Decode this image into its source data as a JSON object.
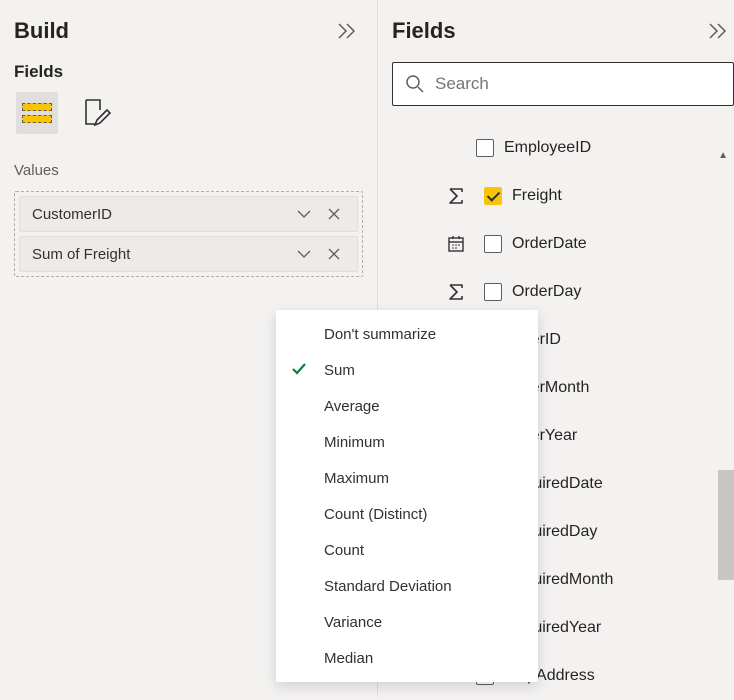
{
  "build": {
    "title": "Build",
    "fields_label": "Fields",
    "values_label": "Values",
    "values": [
      {
        "label": "CustomerID"
      },
      {
        "label": "Sum of Freight"
      }
    ]
  },
  "fields_panel": {
    "title": "Fields",
    "search_placeholder": "Search",
    "fields": [
      {
        "label": "EmployeeID",
        "checked": false,
        "type": "none"
      },
      {
        "label": "Freight",
        "checked": true,
        "type": "sigma"
      },
      {
        "label": "OrderDate",
        "checked": false,
        "type": "calendar"
      },
      {
        "label": "OrderDay",
        "checked": false,
        "type": "sigma"
      },
      {
        "label": "OrderID",
        "checked": false,
        "type": "none"
      },
      {
        "label": "OrderMonth",
        "checked": false,
        "type": "none"
      },
      {
        "label": "OrderYear",
        "checked": false,
        "type": "none"
      },
      {
        "label": "RequiredDate",
        "checked": false,
        "type": "none"
      },
      {
        "label": "RequiredDay",
        "checked": false,
        "type": "none"
      },
      {
        "label": "RequiredMonth",
        "checked": false,
        "type": "none"
      },
      {
        "label": "RequiredYear",
        "checked": false,
        "type": "none"
      },
      {
        "label": "ShipAddress",
        "checked": false,
        "type": "none"
      }
    ]
  },
  "context_menu": {
    "items": [
      {
        "label": "Don't summarize",
        "checked": false
      },
      {
        "label": "Sum",
        "checked": true
      },
      {
        "label": "Average",
        "checked": false
      },
      {
        "label": "Minimum",
        "checked": false
      },
      {
        "label": "Maximum",
        "checked": false
      },
      {
        "label": "Count (Distinct)",
        "checked": false
      },
      {
        "label": "Count",
        "checked": false
      },
      {
        "label": "Standard Deviation",
        "checked": false
      },
      {
        "label": "Variance",
        "checked": false
      },
      {
        "label": "Median",
        "checked": false
      }
    ]
  }
}
